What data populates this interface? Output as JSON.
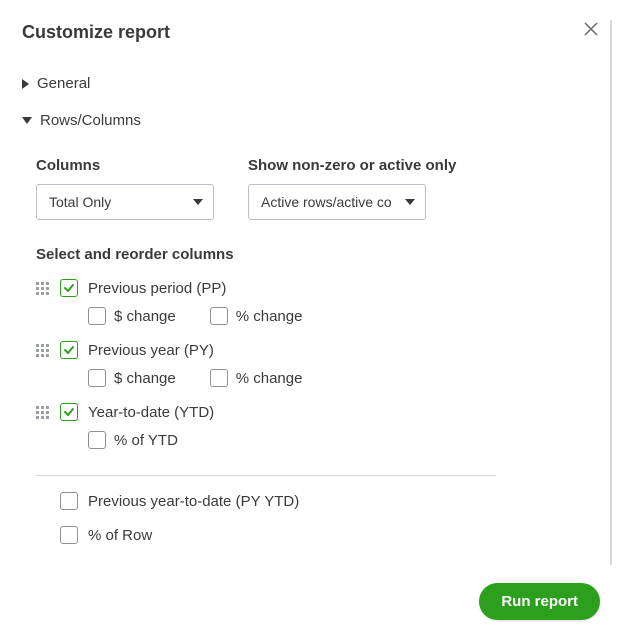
{
  "title": "Customize report",
  "sections": {
    "general": {
      "label": "General",
      "expanded": false
    },
    "rows_columns": {
      "label": "Rows/Columns",
      "expanded": true
    }
  },
  "columns": {
    "label": "Columns",
    "value": "Total Only"
  },
  "show_nonzero": {
    "label": "Show non-zero or active only",
    "value": "Active rows/active co"
  },
  "reorder_label": "Select and reorder columns",
  "items": [
    {
      "label": "Previous period (PP)",
      "checked": true,
      "sub": [
        {
          "label": "$ change",
          "checked": false
        },
        {
          "label": "% change",
          "checked": false
        }
      ]
    },
    {
      "label": "Previous year (PY)",
      "checked": true,
      "sub": [
        {
          "label": "$ change",
          "checked": false
        },
        {
          "label": "% change",
          "checked": false
        }
      ]
    },
    {
      "label": "Year-to-date (YTD)",
      "checked": true,
      "sub": [
        {
          "label": "% of YTD",
          "checked": false
        }
      ]
    }
  ],
  "extra": [
    {
      "label": "Previous year-to-date (PY YTD)",
      "checked": false
    },
    {
      "label": "% of Row",
      "checked": false
    }
  ],
  "run_label": "Run report"
}
